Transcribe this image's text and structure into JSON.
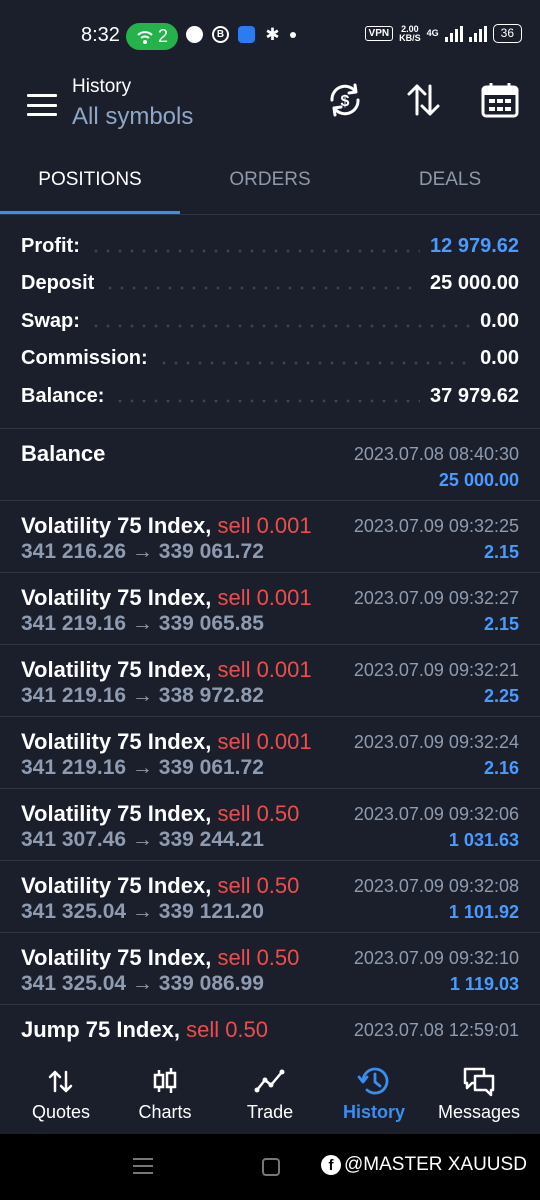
{
  "status_bar": {
    "time": "8:32",
    "hotspot_count": "2",
    "vpn": "VPN",
    "speed_value": "2.00",
    "speed_unit": "KB/S",
    "network": "4G",
    "battery": "36"
  },
  "header": {
    "title": "History",
    "subtitle": "All symbols"
  },
  "tabs": [
    {
      "label": "POSITIONS",
      "active": true
    },
    {
      "label": "ORDERS",
      "active": false
    },
    {
      "label": "DEALS",
      "active": false
    }
  ],
  "summary": {
    "profit_label": "Profit:",
    "profit_value": "12 979.62",
    "deposit_label": "Deposit",
    "deposit_value": "25 000.00",
    "swap_label": "Swap:",
    "swap_value": "0.00",
    "commission_label": "Commission:",
    "commission_value": "0.00",
    "balance_label": "Balance:",
    "balance_value": "37 979.62"
  },
  "balance_entry": {
    "label": "Balance",
    "time": "2023.07.08 08:40:30",
    "amount": "25 000.00"
  },
  "deals": [
    {
      "symbol": "Volatility 75 Index,",
      "action": "sell 0.001",
      "prices": "341 216.26 → 339 061.72",
      "time": "2023.07.09 09:32:25",
      "profit": "2.15"
    },
    {
      "symbol": "Volatility 75 Index,",
      "action": "sell 0.001",
      "prices": "341 219.16 → 339 065.85",
      "time": "2023.07.09 09:32:27",
      "profit": "2.15"
    },
    {
      "symbol": "Volatility 75 Index,",
      "action": "sell 0.001",
      "prices": "341 219.16 → 338 972.82",
      "time": "2023.07.09 09:32:21",
      "profit": "2.25"
    },
    {
      "symbol": "Volatility 75 Index,",
      "action": "sell 0.001",
      "prices": "341 219.16 → 339 061.72",
      "time": "2023.07.09 09:32:24",
      "profit": "2.16"
    },
    {
      "symbol": "Volatility 75 Index,",
      "action": "sell 0.50",
      "prices": "341 307.46 → 339 244.21",
      "time": "2023.07.09 09:32:06",
      "profit": "1 031.63"
    },
    {
      "symbol": "Volatility 75 Index,",
      "action": "sell 0.50",
      "prices": "341 325.04 → 339 121.20",
      "time": "2023.07.09 09:32:08",
      "profit": "1 101.92"
    },
    {
      "symbol": "Volatility 75 Index,",
      "action": "sell 0.50",
      "prices": "341 325.04 → 339 086.99",
      "time": "2023.07.09 09:32:10",
      "profit": "1 119.03"
    },
    {
      "symbol": "Jump 75 Index,",
      "action": "sell 0.50",
      "prices": "",
      "time": "2023.07.08 12:59:01",
      "profit": ""
    }
  ],
  "bottom_nav": [
    {
      "label": "Quotes",
      "icon": "quotes-arrows-icon",
      "active": false
    },
    {
      "label": "Charts",
      "icon": "candlestick-icon",
      "active": false
    },
    {
      "label": "Trade",
      "icon": "trade-line-icon",
      "active": false
    },
    {
      "label": "History",
      "icon": "history-clock-icon",
      "active": true
    },
    {
      "label": "Messages",
      "icon": "chat-bubbles-icon",
      "active": false
    }
  ],
  "watermark": "@MASTER XAUUSD",
  "colors": {
    "background": "#1a1f2b",
    "accent_blue": "#3a8ef0",
    "profit_blue": "#4a9aff",
    "sell_red": "#ee4d4d",
    "muted_text": "#8e9bb0"
  }
}
